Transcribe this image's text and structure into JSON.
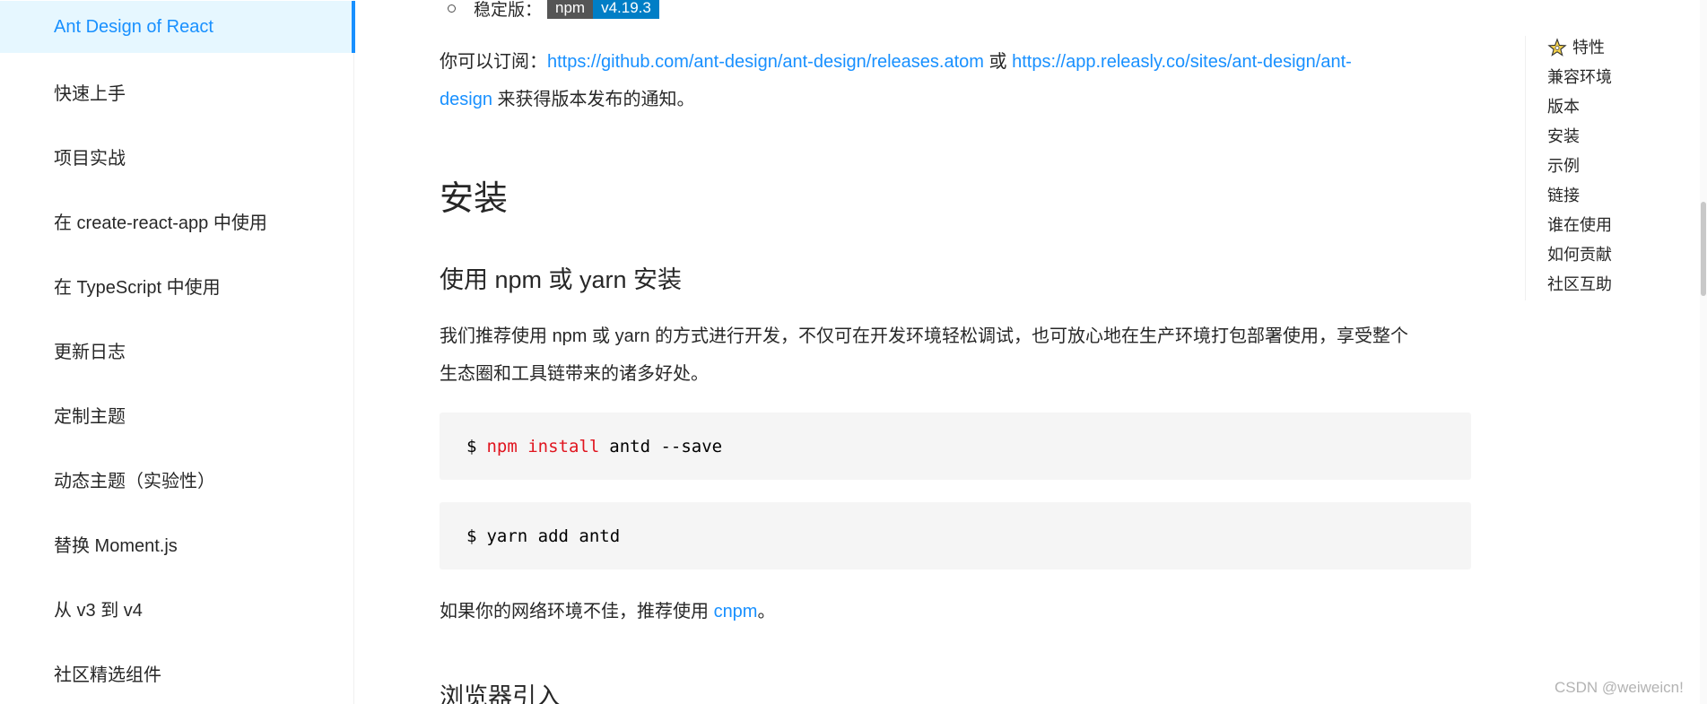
{
  "sidebar": {
    "items": [
      {
        "label": "Ant Design of React",
        "active": true
      },
      {
        "label": "快速上手"
      },
      {
        "label": "项目实战"
      },
      {
        "label": "在 create-react-app 中使用"
      },
      {
        "label": "在 TypeScript 中使用"
      },
      {
        "label": "更新日志"
      },
      {
        "label": "定制主题"
      },
      {
        "label": "动态主题（实验性）"
      },
      {
        "label": "替换 Moment.js"
      },
      {
        "label": "从 v3 到 v4"
      },
      {
        "label": "社区精选组件"
      }
    ]
  },
  "main": {
    "stable": {
      "label": "稳定版：",
      "badge_left": "npm",
      "badge_right": "v4.19.3"
    },
    "subscribe": {
      "prefix": "你可以订阅：",
      "link1": "https://github.com/ant-design/ant-design/releases.atom",
      "or": " 或 ",
      "link2_line1": "https://app.releasly.co/sites/ant-design/ant-",
      "link2_line2": "design",
      "suffix": " 来获得版本发布的通知。"
    },
    "install_heading": "安装",
    "npm_yarn_heading": "使用 npm 或 yarn 安装",
    "recommend": {
      "t1": "我们推荐使用 ",
      "npm": "npm",
      "t2": " 或 ",
      "yarn": "yarn",
      "t3": " 的方式进行开发，不仅可在开发环境轻松调试，也可放心地在生产环境打包部署使用，享受整个",
      "t4": "生态圈和工具链带来的诸多好处。"
    },
    "code1": {
      "prompt": "$",
      "cmd": "npm install",
      "args": "antd --save"
    },
    "code2": {
      "prompt": "$",
      "cmd": "yarn add antd"
    },
    "network": {
      "text": "如果你的网络环境不佳，推荐使用 ",
      "link": "cnpm",
      "suffix": "。"
    },
    "browser_heading": "浏览器引入"
  },
  "toc": {
    "items": [
      "特性",
      "兼容环境",
      "版本",
      "安装",
      "示例",
      "链接",
      "谁在使用",
      "如何贡献",
      "社区互助"
    ]
  },
  "watermark": "CSDN @weiweicn!",
  "colors": {
    "primary": "#1890ff",
    "active_bg": "#e6f7ff",
    "code_bg": "#f5f5f5",
    "code_keyword": "#e0151f",
    "badge_left_bg": "#555555",
    "badge_right_bg": "#007ec6"
  }
}
